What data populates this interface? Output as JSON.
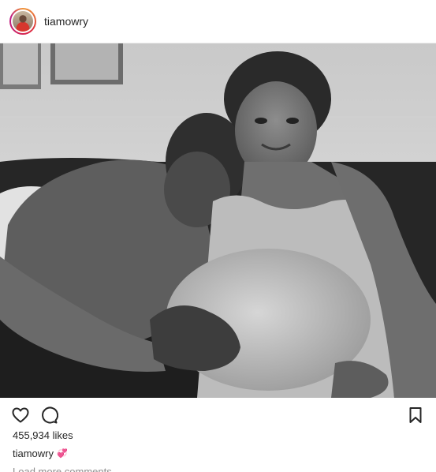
{
  "post": {
    "username": "tiamowry",
    "likes": "455,934 likes",
    "caption": {
      "username": "tiamowry",
      "emoji": "💞"
    },
    "load_more_comments": "Load more comments"
  },
  "icons": {
    "like": "heart-icon",
    "comment": "comment-icon",
    "save": "bookmark-icon"
  },
  "colors": {
    "text": "#262626",
    "muted": "#8e8e8e",
    "divider": "#efefef"
  }
}
